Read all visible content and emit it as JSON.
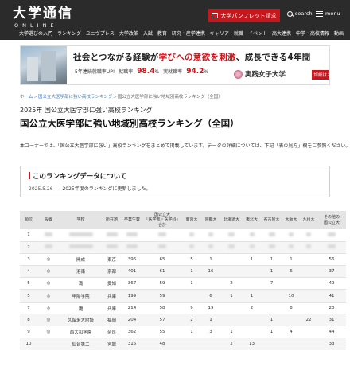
{
  "header": {
    "logo_main": "大学通信",
    "logo_sub": "ONLINE",
    "pamphlet_label": "大学パンフレット請求",
    "search_label": "search",
    "menu_label": "menu",
    "nav": [
      "大学選びの入門",
      "ランキング",
      "ユニヴプレス",
      "大学改革",
      "入試",
      "教育",
      "研究・産学連携",
      "キャリア・就職",
      "イベント",
      "高大連携",
      "中学・高校情報",
      "動画"
    ]
  },
  "banner": {
    "main_before": "社会とつながる経験が",
    "main_highlight": "学びへの意欲を刺激",
    "main_after": "、成長できる4年間",
    "stat1_label": "5年連続就職率UP!",
    "stat2_label": "就職率",
    "stat2_value": "98.4",
    "stat3_label": "実就職率",
    "stat3_value": "94.2",
    "percent": "%",
    "university": "実践女子大学",
    "more_label": "詳細はこちら"
  },
  "breadcrumb": [
    "ホーム",
    "国公立大医学部に強い高校ランキング",
    "国公立大医学部に強い地域別高校ランキング（全国）"
  ],
  "subtitle": "2025年 国公立大医学部に強い高校ランキング",
  "title": "国公立大医学部に強い地域別高校ランキング（全国）",
  "intro": "本コーナーでは、「国公立大医学部に強い」高校ランキングをまとめて掲載しています。データの詳細については、下記「表の見方」欄をご参照ください。",
  "info": {
    "title": "このランキングデータについて",
    "date": "2025.5.26",
    "text": "2025年度のランキングに更新しました。"
  },
  "table": {
    "headers": [
      "順位",
      "設置",
      "学校",
      "所在地",
      "卒業生数",
      "国公立大\n「医学部・医学科」合計",
      "東京大",
      "京都大",
      "北海道大",
      "東北大",
      "名古屋大",
      "大阪大",
      "九州大",
      "その他の\n国公立大"
    ],
    "rows": [
      {
        "rank": "1",
        "type": "",
        "school": "",
        "pref": "",
        "grads": "",
        "total": "",
        "tokyo": "",
        "kyoto": "",
        "hokkaido": "",
        "tohoku": "",
        "nagoya": "",
        "osaka": "",
        "kyushu": "",
        "other": "",
        "blurred": true
      },
      {
        "rank": "2",
        "type": "",
        "school": "",
        "pref": "",
        "grads": "",
        "total": "",
        "tokyo": "",
        "kyoto": "",
        "hokkaido": "",
        "tohoku": "",
        "nagoya": "",
        "osaka": "",
        "kyushu": "",
        "other": "",
        "blurred": true
      },
      {
        "rank": "3",
        "type": "◎",
        "school": "開成",
        "pref": "東京",
        "grads": "396",
        "total": "65",
        "tokyo": "5",
        "kyoto": "1",
        "hokkaido": "",
        "tohoku": "1",
        "nagoya": "1",
        "osaka": "1",
        "kyushu": "",
        "other": "56",
        "blurred": false
      },
      {
        "rank": "4",
        "type": "◎",
        "school": "洛南",
        "pref": "京都",
        "grads": "401",
        "total": "61",
        "tokyo": "1",
        "kyoto": "16",
        "hokkaido": "",
        "tohoku": "",
        "nagoya": "1",
        "osaka": "6",
        "kyushu": "",
        "other": "37",
        "blurred": false
      },
      {
        "rank": "5",
        "type": "◎",
        "school": "滝",
        "pref": "愛知",
        "grads": "367",
        "total": "59",
        "tokyo": "1",
        "kyoto": "",
        "hokkaido": "2",
        "tohoku": "",
        "nagoya": "7",
        "osaka": "",
        "kyushu": "",
        "other": "49",
        "blurred": false
      },
      {
        "rank": "5",
        "type": "◎",
        "school": "甲陽学院",
        "pref": "兵庫",
        "grads": "199",
        "total": "59",
        "tokyo": "",
        "kyoto": "6",
        "hokkaido": "1",
        "tohoku": "1",
        "nagoya": "",
        "osaka": "10",
        "kyushu": "",
        "other": "41",
        "blurred": false
      },
      {
        "rank": "7",
        "type": "◎",
        "school": "灘",
        "pref": "兵庫",
        "grads": "214",
        "total": "58",
        "tokyo": "9",
        "kyoto": "19",
        "hokkaido": "",
        "tohoku": "2",
        "nagoya": "",
        "osaka": "8",
        "kyushu": "",
        "other": "20",
        "blurred": false
      },
      {
        "rank": "8",
        "type": "◎",
        "school": "久留米大附設",
        "pref": "福岡",
        "grads": "204",
        "total": "57",
        "tokyo": "2",
        "kyoto": "1",
        "hokkaido": "",
        "tohoku": "",
        "nagoya": "1",
        "osaka": "",
        "kyushu": "22",
        "other": "31",
        "blurred": false
      },
      {
        "rank": "9",
        "type": "◎",
        "school": "西大和学園",
        "pref": "奈良",
        "grads": "362",
        "total": "55",
        "tokyo": "1",
        "kyoto": "3",
        "hokkaido": "1",
        "tohoku": "",
        "nagoya": "1",
        "osaka": "4",
        "kyushu": "",
        "other": "44",
        "blurred": false
      },
      {
        "rank": "10",
        "type": "",
        "school": "仙台第二",
        "pref": "宮城",
        "grads": "315",
        "total": "48",
        "tokyo": "",
        "kyoto": "",
        "hokkaido": "2",
        "tohoku": "13",
        "nagoya": "",
        "osaka": "",
        "kyushu": "",
        "other": "33",
        "blurred": false
      }
    ]
  }
}
